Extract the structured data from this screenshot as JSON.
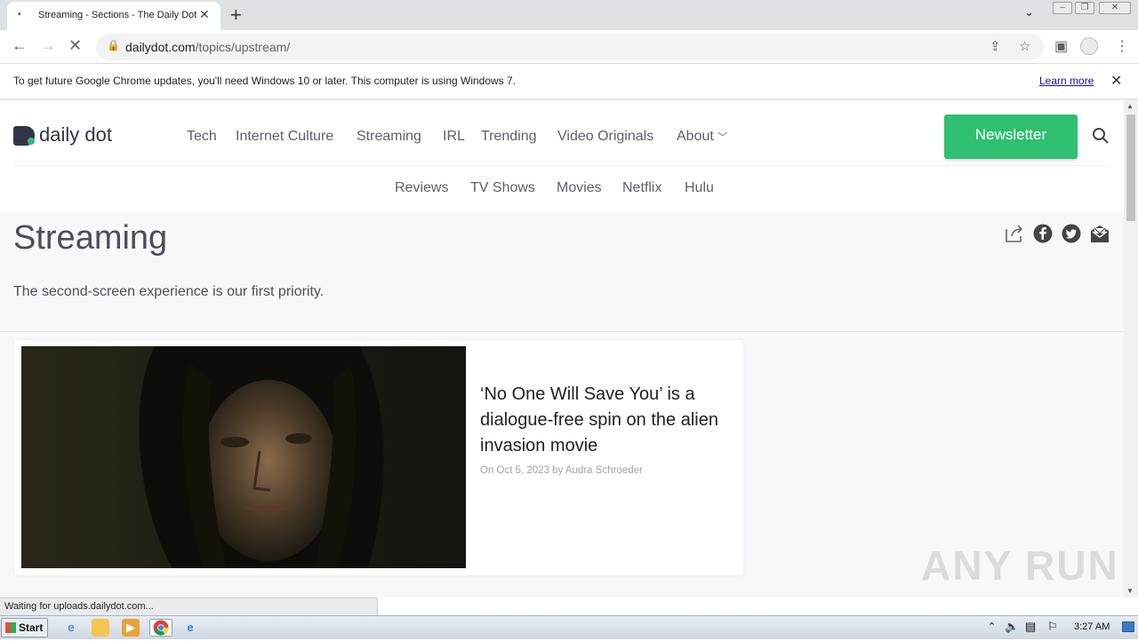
{
  "browser": {
    "tab_title": "Streaming - Sections - The Daily Dot",
    "url_domain": "dailydot.com",
    "url_path": "/topics/upstream/",
    "infobar_message": "To get future Google Chrome updates, you'll need Windows 10 or later. This computer is using Windows 7.",
    "infobar_link": "Learn more",
    "status_text": "Waiting for uploads.dailydot.com..."
  },
  "site": {
    "logo_text": "daily dot",
    "nav": [
      "Tech",
      "Internet Culture",
      "Streaming",
      "IRL",
      "Trending",
      "Video Originals",
      "About"
    ],
    "newsletter_label": "Newsletter",
    "subnav": [
      "Reviews",
      "TV Shows",
      "Movies",
      "Netflix",
      "Hulu"
    ],
    "accent_color": "#2fbf71",
    "text_color": "#4a4e5e"
  },
  "section": {
    "title": "Streaming",
    "description": "The second-screen experience is our first priority."
  },
  "feature": {
    "title": "‘No One Will Save You’ is a dialogue-free spin on the alien invasion movie",
    "meta": "On Oct 5, 2023 by Audra Schroeder"
  },
  "watermark": "ANY RUN",
  "taskbar": {
    "start_label": "Start",
    "clock": "3:27 AM"
  }
}
